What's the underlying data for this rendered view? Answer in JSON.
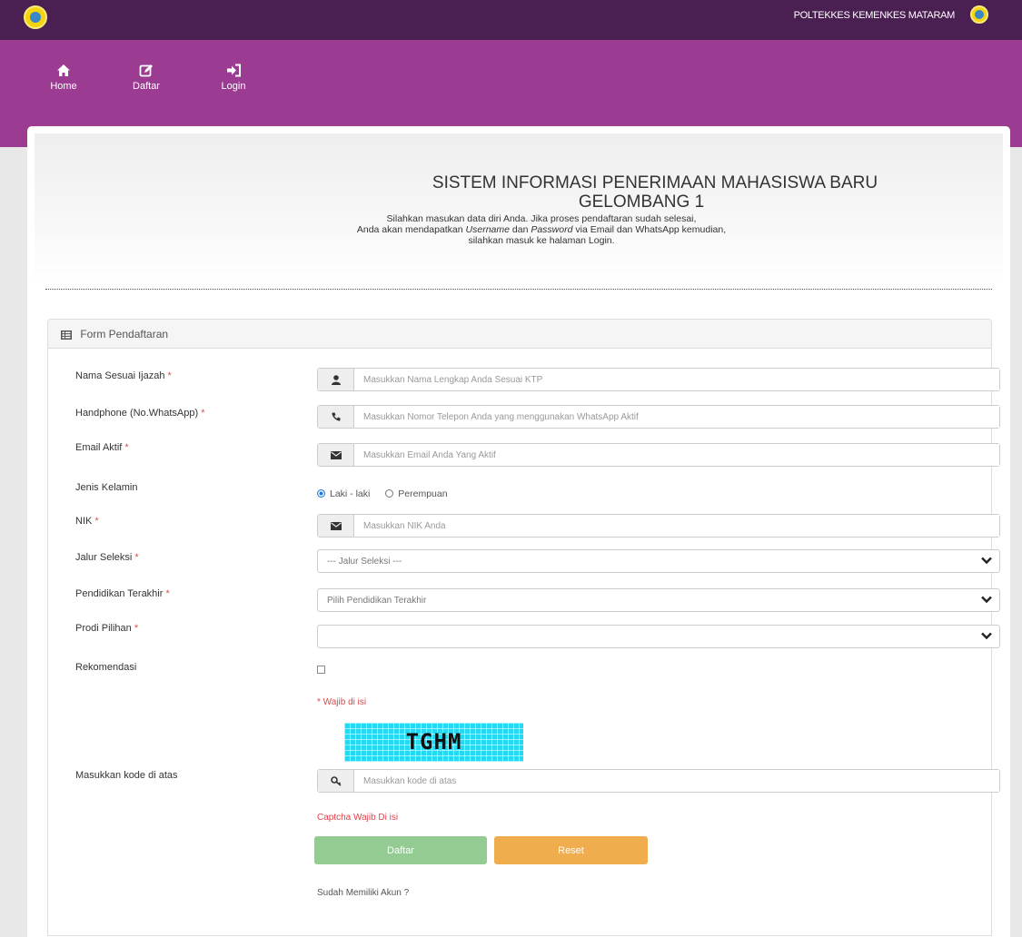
{
  "header": {
    "institution": "POLTEKKES KEMENKES MATARAM"
  },
  "nav": [
    {
      "label": "Home",
      "icon": "home-icon"
    },
    {
      "label": "Daftar",
      "icon": "edit-icon"
    },
    {
      "label": "Login",
      "icon": "sign-in-icon"
    }
  ],
  "hero": {
    "title_line1": "SISTEM INFORMASI PENERIMAAN MAHASISWA BARU",
    "title_line2": "GELOMBANG 1",
    "desc_line1": "Silahkan masukan data diri Anda. Jika proses pendaftaran sudah selesai,",
    "desc_line2_pre": "Anda akan mendapatkan ",
    "desc_line2_username": "Username",
    "desc_line2_mid": " dan ",
    "desc_line2_password": "Password",
    "desc_line2_post": " via Email dan WhatsApp kemudian,",
    "desc_line3": "silahkan masuk ke halaman Login."
  },
  "form": {
    "title": "Form Pendaftaran",
    "required_mark": "*",
    "nama": {
      "label": "Nama Sesuai Ijazah",
      "placeholder": "Masukkan Nama Lengkap Anda Sesuai KTP"
    },
    "hp": {
      "label": "Handphone (No.WhatsApp)",
      "placeholder": "Masukkan Nomor Telepon Anda yang menggunakan WhatsApp Aktif"
    },
    "email": {
      "label": "Email Aktif",
      "placeholder": "Masukkan Email Anda Yang Aktif"
    },
    "gender": {
      "label": "Jenis Kelamin",
      "option1": "Laki - laki",
      "option2": "Perempuan",
      "selected": "Laki - laki"
    },
    "nik": {
      "label": "NIK",
      "placeholder": "Masukkan NIK Anda"
    },
    "jalur": {
      "label": "Jalur Seleksi",
      "value": "--- Jalur Seleksi ---"
    },
    "pendidikan": {
      "label": "Pendidikan Terakhir",
      "value": "Pilih Pendidikan Terakhir"
    },
    "prodi": {
      "label": "Prodi Pilihan",
      "value": ""
    },
    "rekomendasi": {
      "label": "Rekomendasi",
      "checked": false
    },
    "wajib_note": "* Wajib di isi",
    "captcha_text": "TGHM",
    "kode": {
      "label": "Masukkan kode di atas",
      "placeholder": "Masukkan kode di atas"
    },
    "captcha_note": "Captcha Wajib Di isi",
    "submit_label": "Daftar",
    "reset_label": "Reset",
    "account_text": "Sudah Memiliki Akun ?"
  },
  "colors": {
    "topbar": "#4a1f52",
    "navband": "#9b3c92",
    "daftar_button": "#93cb93",
    "reset_button": "#efad4e",
    "required": "#d9534f",
    "captcha_bg": "#25d9f3"
  }
}
